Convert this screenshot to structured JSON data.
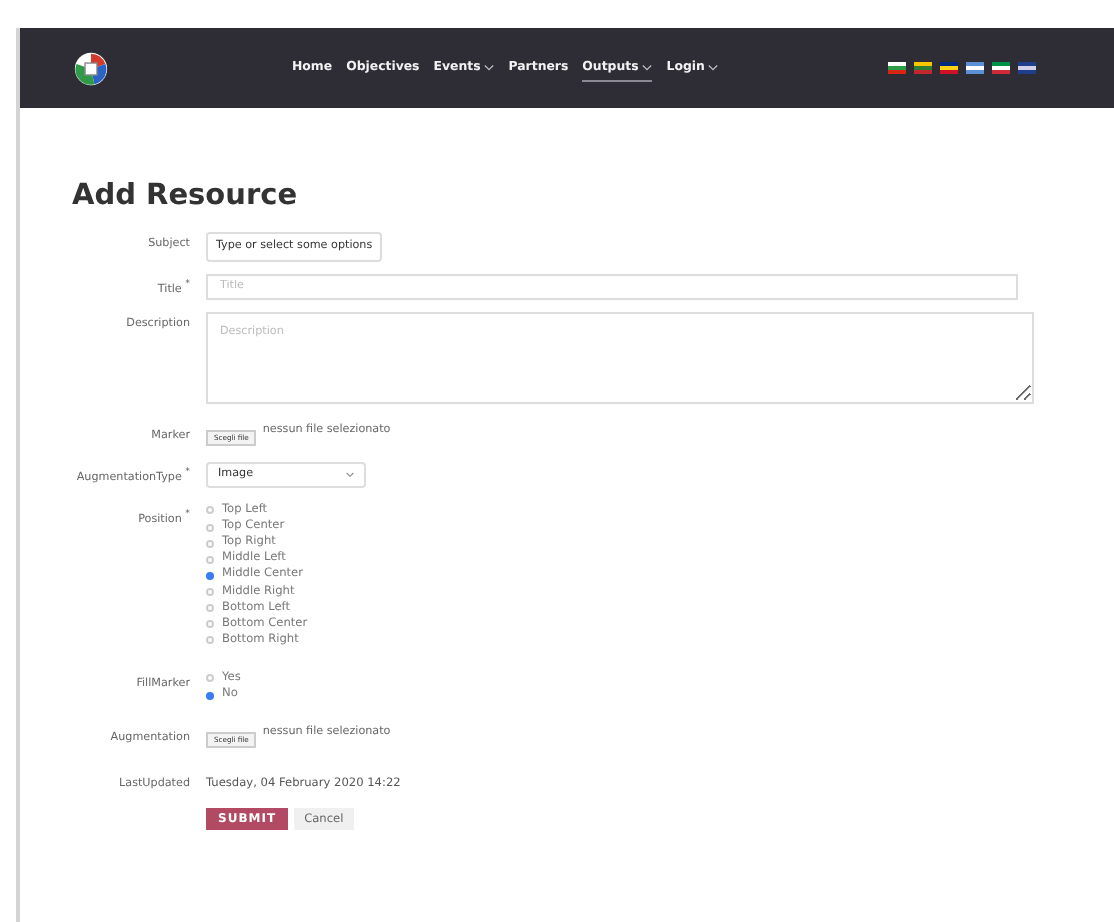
{
  "navbar": {
    "items": [
      {
        "label": "Home",
        "dropdown": false,
        "selected": false
      },
      {
        "label": "Objectives",
        "dropdown": false,
        "selected": false
      },
      {
        "label": "Events",
        "dropdown": true,
        "selected": false
      },
      {
        "label": "Partners",
        "dropdown": false,
        "selected": false
      },
      {
        "label": "Outputs",
        "dropdown": true,
        "selected": true
      },
      {
        "label": "Login",
        "dropdown": true,
        "selected": false
      }
    ]
  },
  "form": {
    "title": "Add Resource",
    "subject": {
      "label": "Subject",
      "value": "Type or select some options"
    },
    "title_field": {
      "label": "Title $^{*}$",
      "placeholder": "Title"
    },
    "description": {
      "label": "Description",
      "placeholder": "Description"
    },
    "marker": {
      "label": "Marker",
      "button": "Scegli file",
      "status": "nessun file selezionato"
    },
    "augmentation_type": {
      "label": "AugmentationType $^{*}$",
      "value": "Image"
    },
    "position": {
      "label": "Position $^{*}$",
      "options": [
        {
          "label": "Top Left",
          "selected": false
        },
        {
          "label": "Top Center",
          "selected": false
        },
        {
          "label": "Top Right",
          "selected": false
        },
        {
          "label": "Middle Left",
          "selected": false
        },
        {
          "label": "Middle Center",
          "selected": true
        },
        {
          "label": "Middle Right",
          "selected": false
        },
        {
          "label": "Bottom Left",
          "selected": false
        },
        {
          "label": "Bottom Center",
          "selected": false
        },
        {
          "label": "Bottom Right",
          "selected": false
        }
      ]
    },
    "fill_marker": {
      "label": "FillMarker",
      "options": [
        {
          "label": "Yes",
          "selected": false
        },
        {
          "label": "No",
          "selected": true
        }
      ]
    },
    "augmentation": {
      "label": "Augmentation",
      "button": "Scegli file",
      "status": "nessun file selezionato"
    },
    "last_updated": {
      "label": "LastUpdated",
      "value": "Tuesday, 04 February 2020 14:22"
    },
    "buttons": {
      "submit": "SUBMIT",
      "cancel": "Cancel"
    }
  }
}
